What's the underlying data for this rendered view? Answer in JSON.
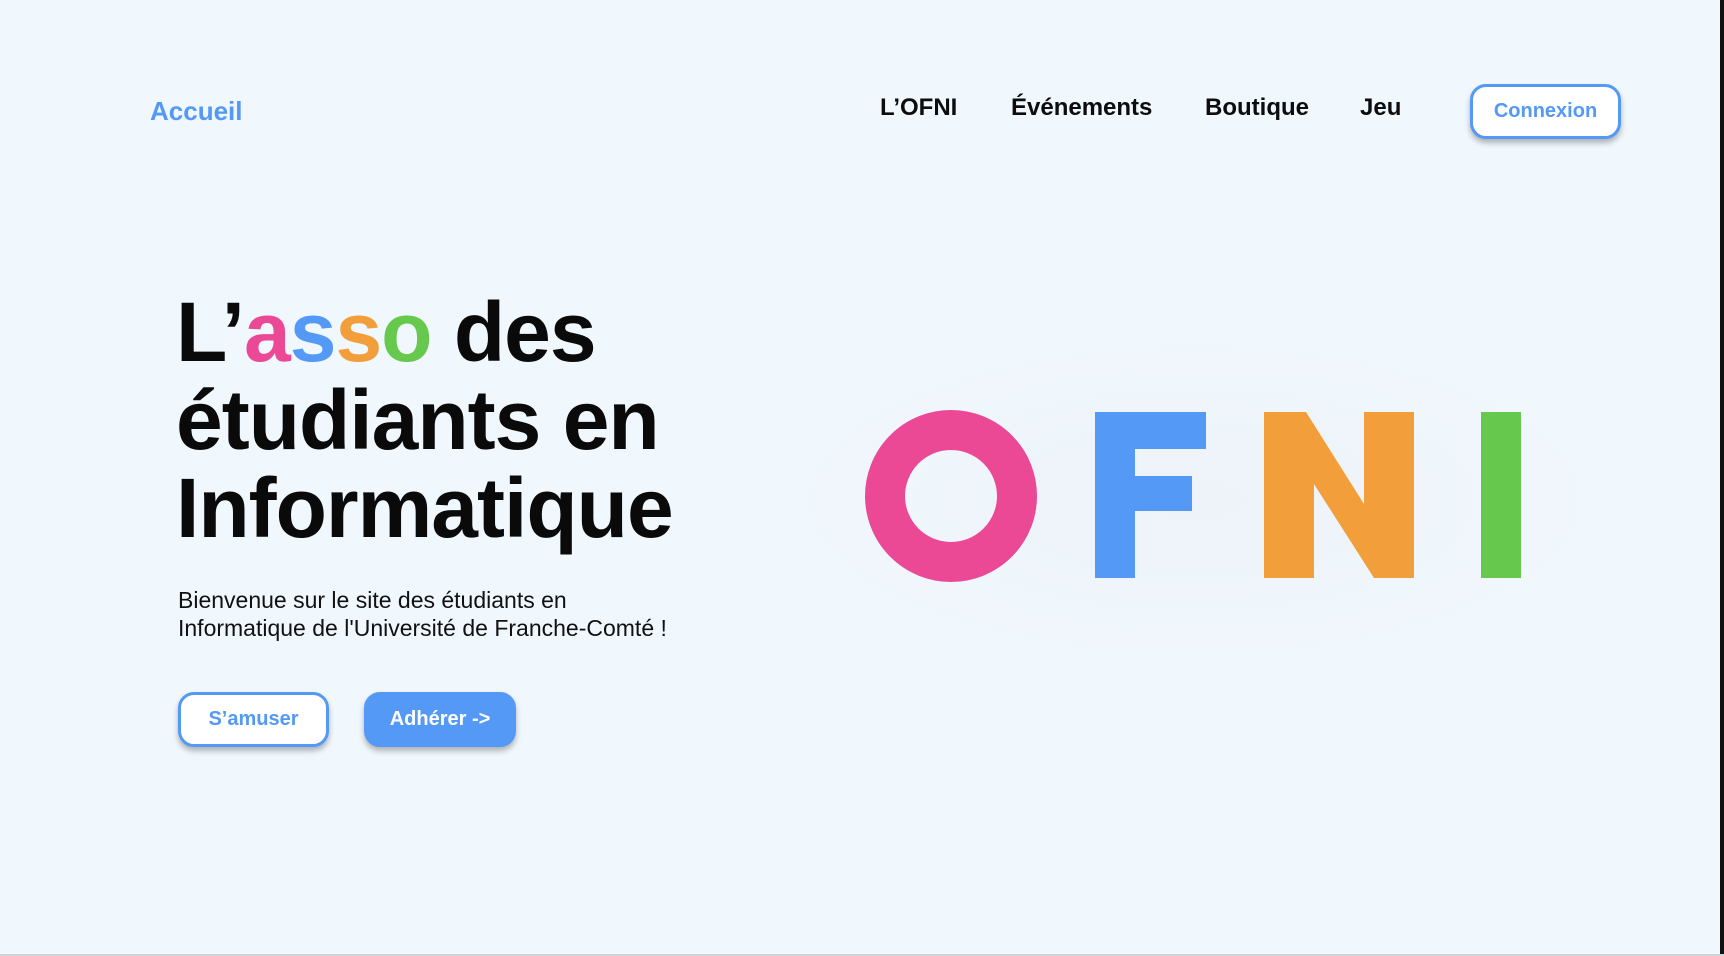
{
  "header": {
    "home_label": "Accueil",
    "nav": {
      "ofni": "L’OFNI",
      "events": "Événements",
      "shop": "Boutique",
      "game": "Jeu"
    },
    "login_label": "Connexion"
  },
  "hero": {
    "title_prefix": "L’",
    "title_asso": [
      "a",
      "s",
      "s",
      "o"
    ],
    "title_line1_end": " des",
    "title_line2": "étudiants en",
    "title_line3": "Informatique",
    "subtitle_line1": "Bienvenue sur le site des étudiants en",
    "subtitle_line2": "Informatique de l'Université de Franche-Comté !",
    "play_label": "S’amuser",
    "join_label": "Adhérer ->"
  },
  "logo": {
    "letters": [
      "O",
      "F",
      "N",
      "I"
    ]
  },
  "colors": {
    "pink": "#eb4896",
    "blue": "#5399f5",
    "orange": "#f19e3b",
    "green": "#66c94d",
    "background": "#f0f7fd"
  },
  "icons": {
    "logo": "ofni-logo"
  }
}
